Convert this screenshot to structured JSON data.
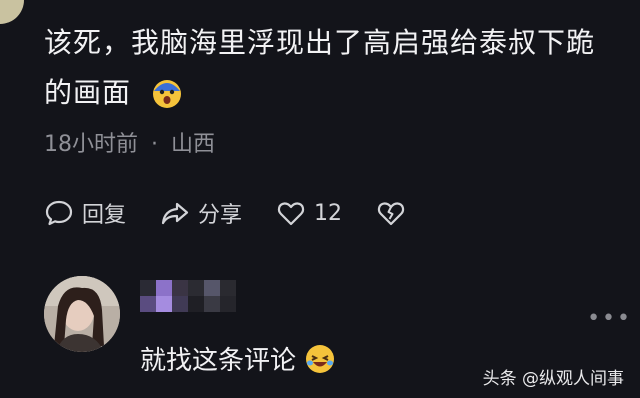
{
  "comment": {
    "text": "该死，我脑海里浮现出了高启强给泰叔下跪的画面",
    "emoji_icon": "shocked-face-emoji",
    "time": "18小时前",
    "separator": "·",
    "location": "山西"
  },
  "actions": {
    "reply_label": "回复",
    "share_label": "分享",
    "like_count": "12"
  },
  "reply": {
    "text": "就找这条评论",
    "emoji_icon": "laughing-crying-emoji"
  },
  "watermark": {
    "brand": "头条",
    "account": "@纵观人间事"
  },
  "more_icon": "more-horizontal-icon",
  "colors": {
    "background": "#13141a",
    "text_primary": "#f2f2f4",
    "text_secondary": "#8f9097",
    "mosaic_purple": "#8c72c9"
  }
}
